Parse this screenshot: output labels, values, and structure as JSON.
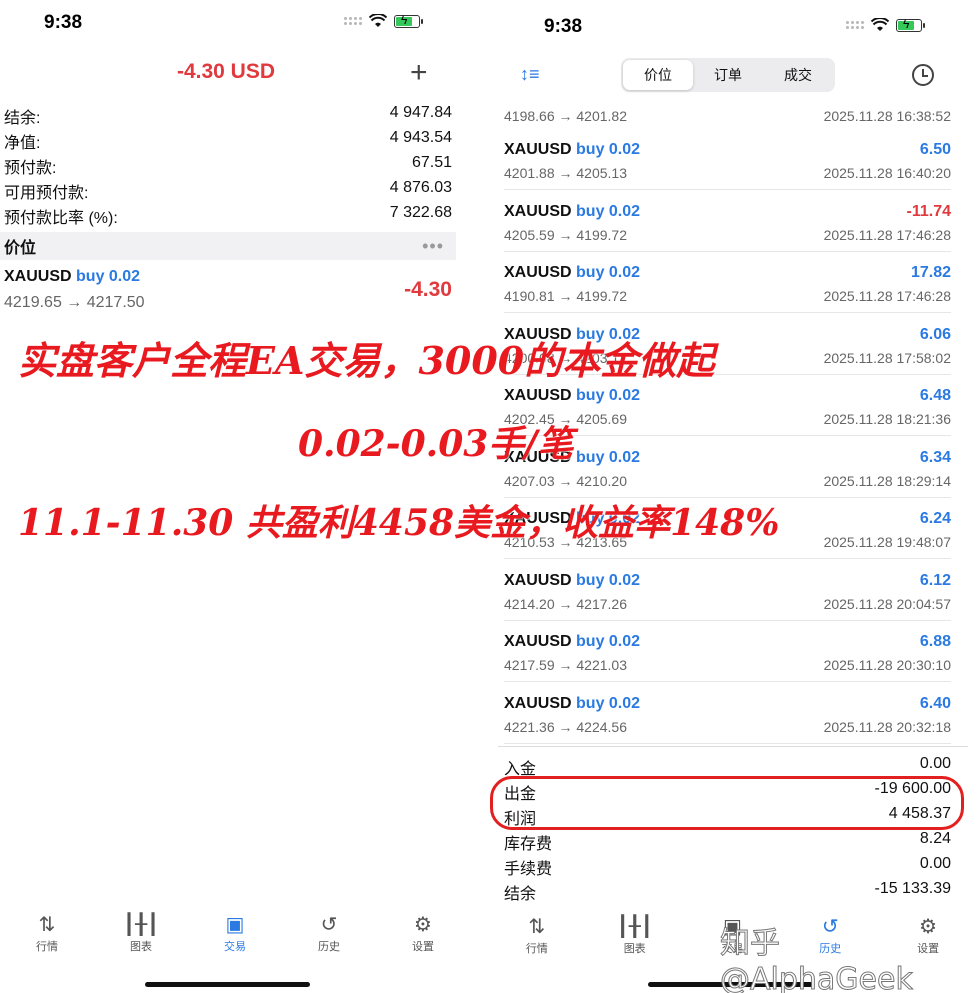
{
  "left": {
    "status_time": "9:38",
    "balance_title": "-4.30 USD",
    "account_rows": [
      {
        "label": "结余:",
        "value": "4 947.84"
      },
      {
        "label": "净值:",
        "value": "4 943.54"
      },
      {
        "label": "预付款:",
        "value": "67.51"
      },
      {
        "label": "可用预付款:",
        "value": "4 876.03"
      },
      {
        "label": "预付款比率 (%):",
        "value": "7 322.68"
      }
    ],
    "section_label": "价位",
    "position": {
      "symbol": "XAUUSD",
      "side": "buy 0.02",
      "prices": "4219.65 → 4217.50",
      "profit": "-4.30"
    }
  },
  "right": {
    "status_time": "9:38",
    "segments": [
      "价位",
      "订单",
      "成交"
    ],
    "active_segment": 0,
    "partial": {
      "prices": "4198.66 → 4201.82",
      "time": "2025.11.28 16:38:52"
    },
    "deals": [
      {
        "symbol": "XAUUSD",
        "side": "buy 0.02",
        "profit": "6.50",
        "prices": "4201.88 → 4205.13",
        "time": "2025.11.28 16:40:20"
      },
      {
        "symbol": "XAUUSD",
        "side": "buy 0.02",
        "profit": "-11.74",
        "prices": "4205.59 → 4199.72",
        "time": "2025.11.28 17:46:28"
      },
      {
        "symbol": "XAUUSD",
        "side": "buy 0.02",
        "profit": "17.82",
        "prices": "4190.81 → 4199.72",
        "time": "2025.11.28 17:46:28"
      },
      {
        "symbol": "XAUUSD",
        "side": "buy 0.02",
        "profit": "6.06",
        "prices": "4200.08 → 4203.11",
        "time": "2025.11.28 17:58:02"
      },
      {
        "symbol": "XAUUSD",
        "side": "buy 0.02",
        "profit": "6.48",
        "prices": "4202.45 → 4205.69",
        "time": "2025.11.28 18:21:36"
      },
      {
        "symbol": "XAUUSD",
        "side": "buy 0.02",
        "profit": "6.34",
        "prices": "4207.03 → 4210.20",
        "time": "2025.11.28 18:29:14"
      },
      {
        "symbol": "XAUUSD",
        "side": "buy 0.02",
        "profit": "6.24",
        "prices": "4210.53 → 4213.65",
        "time": "2025.11.28 19:48:07"
      },
      {
        "symbol": "XAUUSD",
        "side": "buy 0.02",
        "profit": "6.12",
        "prices": "4214.20 → 4217.26",
        "time": "2025.11.28 20:04:57"
      },
      {
        "symbol": "XAUUSD",
        "side": "buy 0.02",
        "profit": "6.88",
        "prices": "4217.59 → 4221.03",
        "time": "2025.11.28 20:30:10"
      },
      {
        "symbol": "XAUUSD",
        "side": "buy 0.02",
        "profit": "6.40",
        "prices": "4221.36 → 4224.56",
        "time": "2025.11.28 20:32:18"
      }
    ],
    "summary": [
      {
        "label": "入金",
        "value": "0.00"
      },
      {
        "label": "出金",
        "value": "-19 600.00"
      },
      {
        "label": "利润",
        "value": "4 458.37"
      },
      {
        "label": "库存费",
        "value": "8.24"
      },
      {
        "label": "手续费",
        "value": "0.00"
      },
      {
        "label": "结余",
        "value": "-15 133.39"
      }
    ]
  },
  "tabs": [
    {
      "label": "行情",
      "icon": "arrows-updown-icon"
    },
    {
      "label": "图表",
      "icon": "candlestick-icon"
    },
    {
      "label": "交易",
      "icon": "trade-chart-icon"
    },
    {
      "label": "历史",
      "icon": "history-icon"
    },
    {
      "label": "设置",
      "icon": "gear-icon"
    }
  ],
  "left_active_tab": 2,
  "right_active_tab": 3,
  "overlay": {
    "line1": "实盘客户全程EA交易，3000的本金做起",
    "line2": "0.02-0.03手/笔",
    "line3": "11.1-11.30 共盈利4458美金，收益率148%"
  },
  "watermark": "知乎 @AlphaGeek",
  "colors": {
    "accent": "#2a7ae2",
    "loss": "#e0393e",
    "overlay_red": "#e8191f"
  }
}
